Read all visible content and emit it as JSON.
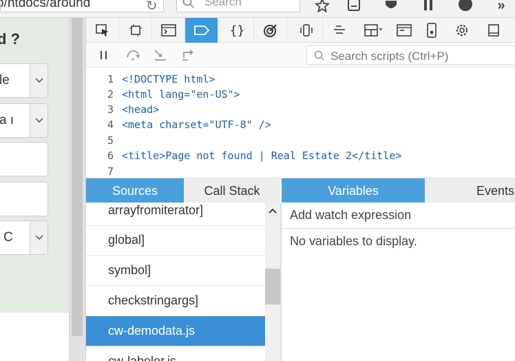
{
  "browser": {
    "url_fragment": "o/htdocs/around",
    "search_placeholder": "Search"
  },
  "page": {
    "heading": "d ?",
    "fields": [
      {
        "value": "le"
      },
      {
        "value": "a ı"
      },
      {
        "value": ""
      },
      {
        "value": ""
      },
      {
        "value": "C"
      }
    ]
  },
  "devtools": {
    "toolbar_icons": [
      "inspector-icon",
      "box-model-icon",
      "console-icon",
      "debugger-icon",
      "style-editor-icon",
      "performance-icon",
      "accessibility-icon",
      "align-icon",
      "layout-icon",
      "storage-icon",
      "responsive-icon",
      "settings-icon",
      "dock-icon"
    ],
    "active_tool_index": 3,
    "script_search_placeholder": "Search scripts (Ctrl+P)",
    "code_lines": [
      {
        "num": "1",
        "text": "<!DOCTYPE html>"
      },
      {
        "num": "2",
        "text": "<html lang=\"en-US\">"
      },
      {
        "num": "3",
        "text": "<head>"
      },
      {
        "num": "4",
        "text": "<meta charset=\"UTF-8\" />"
      },
      {
        "num": "5",
        "text": ""
      },
      {
        "num": "6",
        "text": "<title>Page not found | Real Estate 2</title>"
      },
      {
        "num": "7",
        "text": ""
      }
    ],
    "tabs_left": [
      "Sources",
      "Call Stack"
    ],
    "tabs_right": [
      "Variables",
      "Events"
    ],
    "sources": [
      "arrayfromiterator]",
      "global]",
      "symbol]",
      "checkstringargs]",
      "cw-demodata.js",
      "cw-labeler.js"
    ],
    "selected_source_index": 4,
    "watch_label": "Add watch expression",
    "no_vars_text": "No variables to display.",
    "accent_color": "#3a9be0"
  }
}
